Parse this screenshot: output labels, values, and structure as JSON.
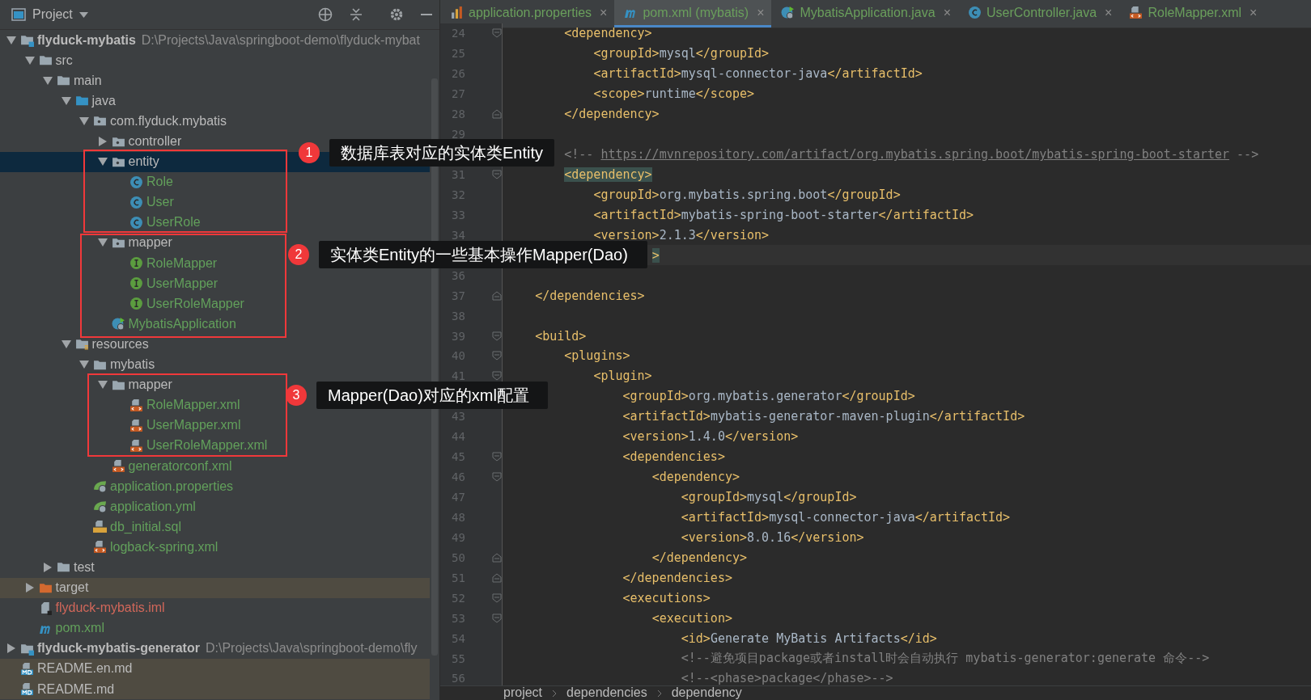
{
  "project_panel": {
    "title": "Project"
  },
  "tree": [
    {
      "name": "flyduck-mybatis",
      "kind": "module",
      "path": "D:\\Projects\\Java\\springboot-demo\\flyduck-mybat",
      "expanded": true,
      "selected": false,
      "excluded": false,
      "color": "#bbbbbb",
      "children": [
        {
          "name": "src",
          "kind": "folder",
          "expanded": true,
          "selected": false,
          "excluded": false,
          "color": "#bbbbbb",
          "children": [
            {
              "name": "main",
              "kind": "folder",
              "expanded": true,
              "selected": false,
              "excluded": false,
              "color": "#bbbbbb",
              "children": [
                {
                  "name": "java",
                  "kind": "source-folder",
                  "expanded": true,
                  "selected": false,
                  "excluded": false,
                  "color": "#bbbbbb",
                  "children": [
                    {
                      "name": "com.flyduck.mybatis",
                      "kind": "package",
                      "expanded": true,
                      "selected": false,
                      "excluded": false,
                      "color": "#bbbbbb",
                      "children": [
                        {
                          "name": "controller",
                          "kind": "package",
                          "expanded": false,
                          "selected": false,
                          "excluded": false,
                          "color": "#bbbbbb"
                        },
                        {
                          "name": "entity",
                          "kind": "package",
                          "expanded": true,
                          "selected": true,
                          "excluded": false,
                          "color": "#bbbbbb",
                          "children": [
                            {
                              "name": "Role",
                              "kind": "class",
                              "selected": false,
                              "excluded": false,
                              "color": "#62a05b"
                            },
                            {
                              "name": "User",
                              "kind": "class",
                              "selected": false,
                              "excluded": false,
                              "color": "#62a05b"
                            },
                            {
                              "name": "UserRole",
                              "kind": "class",
                              "selected": false,
                              "excluded": false,
                              "color": "#62a05b"
                            }
                          ]
                        },
                        {
                          "name": "mapper",
                          "kind": "package",
                          "expanded": true,
                          "selected": false,
                          "excluded": false,
                          "color": "#bbbbbb",
                          "children": [
                            {
                              "name": "RoleMapper",
                              "kind": "interface",
                              "selected": false,
                              "excluded": false,
                              "color": "#62a05b"
                            },
                            {
                              "name": "UserMapper",
                              "kind": "interface",
                              "selected": false,
                              "excluded": false,
                              "color": "#62a05b"
                            },
                            {
                              "name": "UserRoleMapper",
                              "kind": "interface",
                              "selected": false,
                              "excluded": false,
                              "color": "#62a05b"
                            }
                          ]
                        },
                        {
                          "name": "MybatisApplication",
                          "kind": "spring-app",
                          "selected": false,
                          "excluded": false,
                          "color": "#62a05b"
                        }
                      ]
                    }
                  ]
                },
                {
                  "name": "resources",
                  "kind": "resources-folder",
                  "expanded": true,
                  "selected": false,
                  "excluded": false,
                  "color": "#bbbbbb",
                  "children": [
                    {
                      "name": "mybatis",
                      "kind": "folder",
                      "expanded": true,
                      "selected": false,
                      "excluded": false,
                      "color": "#bbbbbb",
                      "children": [
                        {
                          "name": "mapper",
                          "kind": "folder",
                          "expanded": true,
                          "selected": false,
                          "excluded": false,
                          "color": "#bbbbbb",
                          "children": [
                            {
                              "name": "RoleMapper.xml",
                              "kind": "xml",
                              "selected": false,
                              "excluded": false,
                              "color": "#62a05b"
                            },
                            {
                              "name": "UserMapper.xml",
                              "kind": "xml",
                              "selected": false,
                              "excluded": false,
                              "color": "#62a05b"
                            },
                            {
                              "name": "UserRoleMapper.xml",
                              "kind": "xml",
                              "selected": false,
                              "excluded": false,
                              "color": "#62a05b"
                            }
                          ]
                        },
                        {
                          "name": "generatorconf.xml",
                          "kind": "xml",
                          "selected": false,
                          "excluded": false,
                          "color": "#62a05b"
                        }
                      ]
                    },
                    {
                      "name": "application.properties",
                      "kind": "spring-config",
                      "selected": false,
                      "excluded": false,
                      "color": "#62a05b"
                    },
                    {
                      "name": "application.yml",
                      "kind": "spring-config",
                      "selected": false,
                      "excluded": false,
                      "color": "#62a05b"
                    },
                    {
                      "name": "db_initial.sql",
                      "kind": "sql",
                      "selected": false,
                      "excluded": false,
                      "color": "#62a05b"
                    },
                    {
                      "name": "logback-spring.xml",
                      "kind": "xml",
                      "selected": false,
                      "excluded": false,
                      "color": "#62a05b"
                    }
                  ]
                }
              ]
            },
            {
              "name": "test",
              "kind": "folder",
              "expanded": false,
              "selected": false,
              "excluded": false,
              "color": "#bbbbbb"
            }
          ]
        },
        {
          "name": "target",
          "kind": "excluded-folder",
          "expanded": false,
          "selected": false,
          "excluded": true,
          "color": "#bbbbbb"
        },
        {
          "name": "flyduck-mybatis.iml",
          "kind": "iml",
          "selected": false,
          "excluded": false,
          "color": "#d1675a"
        },
        {
          "name": "pom.xml",
          "kind": "maven",
          "selected": false,
          "excluded": false,
          "color": "#62a05b"
        }
      ]
    },
    {
      "name": "flyduck-mybatis-generator",
      "kind": "module",
      "path": "D:\\Projects\\Java\\springboot-demo\\fly",
      "expanded": false,
      "selected": false,
      "excluded": false,
      "color": "#bbbbbb"
    },
    {
      "name": "README.en.md",
      "kind": "markdown",
      "selected": false,
      "excluded": true,
      "color": "#bbbbbb"
    },
    {
      "name": "README.md",
      "kind": "markdown",
      "selected": false,
      "excluded": true,
      "color": "#bbbbbb"
    }
  ],
  "tabs": [
    {
      "label": "application.properties",
      "kind": "properties",
      "selected": false,
      "close": "×"
    },
    {
      "label": "pom.xml (mybatis)",
      "kind": "maven",
      "selected": true,
      "close": "×"
    },
    {
      "label": "MybatisApplication.java",
      "kind": "spring-app",
      "selected": false,
      "close": "×"
    },
    {
      "label": "UserController.java",
      "kind": "class",
      "selected": false,
      "close": "×"
    },
    {
      "label": "RoleMapper.xml",
      "kind": "xml",
      "selected": false,
      "close": "×"
    }
  ],
  "code": [
    {
      "number": "24",
      "code": "        <dependency>",
      "fold_start": true,
      "fold_end": false
    },
    {
      "number": "25",
      "code": "            <groupId>mysql</groupId>",
      "fold_start": false,
      "fold_end": false
    },
    {
      "number": "26",
      "code": "            <artifactId>mysql-connector-java</artifactId>",
      "fold_start": false,
      "fold_end": false
    },
    {
      "number": "27",
      "code": "            <scope>runtime</scope>",
      "fold_start": false,
      "fold_end": false
    },
    {
      "number": "28",
      "code": "        </dependency>",
      "fold_start": false,
      "fold_end": true
    },
    {
      "number": "29",
      "fold_start": false,
      "fold_end": false
    },
    {
      "segments": [
        {
          "kind": "comment",
          "text": "        <!-- "
        },
        {
          "kind": "link",
          "text": "https://mvnrepository.com/artifact/org.mybatis.spring.boot/mybatis-spring-boot-starter"
        },
        {
          "kind": "comment",
          "text": " -->"
        }
      ]
    },
    {
      "number": "31",
      "code": "        <dependency>",
      "fold_start": true,
      "fold_end": false,
      "match": true
    },
    {
      "number": "32",
      "code": "            <groupId>org.mybatis.spring.boot</groupId>",
      "fold_start": false,
      "fold_end": false
    },
    {
      "number": "33",
      "code": "            <artifactId>mybatis-spring-boot-starter</artifactId>",
      "fold_start": false,
      "fold_end": false
    },
    {
      "number": "34",
      "code": "            <version>2.1.3</version>",
      "fold_start": false,
      "fold_end": false
    },
    {
      "code": "                    >",
      "fold_start": false,
      "fold_end": false,
      "match": true,
      "current": true
    },
    {
      "number": "36",
      "fold_start": false,
      "fold_end": false
    },
    {
      "number": "37",
      "code": "    </dependencies>",
      "fold_start": false,
      "fold_end": true
    },
    {
      "number": "38",
      "fold_start": false,
      "fold_end": false
    },
    {
      "number": "39",
      "code": "    <build>",
      "fold_start": true,
      "fold_end": false
    },
    {
      "number": "40",
      "code": "        <plugins>",
      "fold_start": true,
      "fold_end": false
    },
    {
      "number": "41",
      "code": "            <plugin>",
      "fold_start": true,
      "fold_end": false
    },
    {
      "code": "                <groupId>org.mybatis.generator</groupId>"
    },
    {
      "number": "43",
      "code": "                <artifactId>mybatis-generator-maven-plugin</artifactId>",
      "fold_start": false,
      "fold_end": false
    },
    {
      "number": "44",
      "code": "                <version>1.4.0</version>",
      "fold_start": false,
      "fold_end": false
    },
    {
      "number": "45",
      "code": "                <dependencies>",
      "fold_start": true,
      "fold_end": false
    },
    {
      "number": "46",
      "code": "                    <dependency>",
      "fold_start": true,
      "fold_end": false
    },
    {
      "number": "47",
      "code": "                        <groupId>mysql</groupId>",
      "fold_start": false,
      "fold_end": false
    },
    {
      "number": "48",
      "code": "                        <artifactId>mysql-connector-java</artifactId>",
      "fold_start": false,
      "fold_end": false
    },
    {
      "number": "49",
      "code": "                        <version>8.0.16</version>",
      "fold_start": false,
      "fold_end": false
    },
    {
      "number": "50",
      "code": "                    </dependency>",
      "fold_start": false,
      "fold_end": true
    },
    {
      "number": "51",
      "code": "                </dependencies>",
      "fold_start": false,
      "fold_end": true
    },
    {
      "number": "52",
      "code": "                <executions>",
      "fold_start": true,
      "fold_end": false
    },
    {
      "number": "53",
      "code": "                    <execution>",
      "fold_start": true,
      "fold_end": false
    },
    {
      "number": "54",
      "code": "                        <id>Generate MyBatis Artifacts</id>",
      "fold_start": false,
      "fold_end": false
    },
    {
      "number": "55",
      "segments": [
        {
          "kind": "comment",
          "text": "                        <!--避免项目package或者install时会自动执行 mybatis-generator:generate 命令-->"
        }
      ],
      "fold_start": false,
      "fold_end": false
    },
    {
      "number": "56",
      "segments": [
        {
          "kind": "comment",
          "text": "                        <!--<phase>package</phase>-->"
        }
      ],
      "fold_start": false,
      "fold_end": false
    }
  ],
  "breadcrumbs": [
    "project",
    "dependencies",
    "dependency"
  ],
  "callouts": [
    {
      "number": "1",
      "text": "数据库表对应的实体类Entity"
    },
    {
      "number": "2",
      "text": "实体类Entity的一些基本操作Mapper(Dao)"
    },
    {
      "number": "3",
      "text": "Mapper(Dao)对应的xml配置"
    }
  ]
}
